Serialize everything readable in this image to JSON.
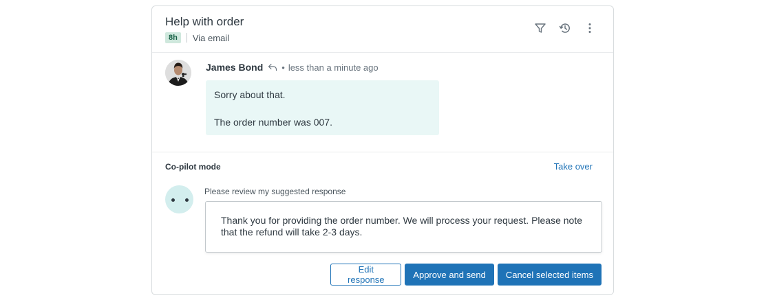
{
  "ticket": {
    "title": "Help with order",
    "age_badge": "8h",
    "channel": "Via email",
    "header_icons": [
      "filter-icon",
      "history-icon",
      "more-vertical-icon"
    ]
  },
  "message": {
    "author": "James Bond",
    "time": "less than a minute ago",
    "separator": "•",
    "lines": [
      "Sorry about that.",
      "The order number was 007."
    ]
  },
  "copilot": {
    "title": "Co-pilot mode",
    "take_over": "Take over",
    "suggestion_label": "Please review my suggested response",
    "suggestion_text": "Thank you for providing the order number. We will process your request. Please note that the refund will take 2-3 days."
  },
  "actions": {
    "edit": "Edit response",
    "approve": "Approve and send",
    "cancel": "Cancel selected items"
  },
  "colors": {
    "accent": "#1f73b7",
    "badge_bg": "#cfe8dd",
    "bubble_bg": "#e9f7f6",
    "bot_bg": "#d3eeee"
  }
}
